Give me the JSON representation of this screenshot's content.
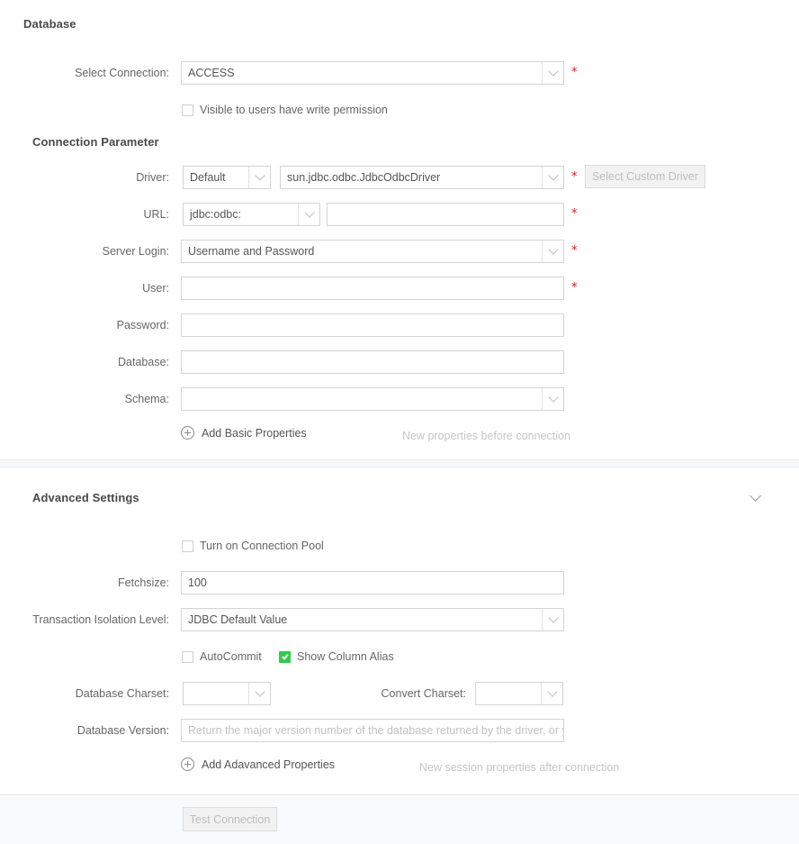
{
  "sections": {
    "database": {
      "title": "Database"
    },
    "connection_parameter": {
      "title": "Connection Parameter"
    },
    "advanced_settings": {
      "title": "Advanced Settings"
    }
  },
  "database": {
    "select_connection": {
      "label": "Select Connection:",
      "value": "ACCESS",
      "required_mark": "*"
    },
    "visible_permission": {
      "label": "Visible to users have write permission",
      "checked": false
    }
  },
  "connection_parameter": {
    "driver": {
      "label": "Driver:",
      "type_value": "Default",
      "class_value": "sun.jdbc.odbc.JdbcOdbcDriver",
      "required_mark": "*",
      "custom_button": "Select Custom Driver"
    },
    "url": {
      "label": "URL:",
      "prefix_value": "jdbc:odbc:",
      "text_value": "",
      "text_placeholder": "",
      "required_mark": "*"
    },
    "server_login": {
      "label": "Server Login:",
      "value": "Username and Password",
      "required_mark": "*"
    },
    "user": {
      "label": "User:",
      "value": "",
      "placeholder": "",
      "required_mark": "*"
    },
    "password": {
      "label": "Password:",
      "value": "",
      "placeholder": ""
    },
    "database": {
      "label": "Database:",
      "value": "",
      "placeholder": ""
    },
    "schema": {
      "label": "Schema:",
      "value": ""
    },
    "add_basic_properties": {
      "label": "Add Basic Properties",
      "hint": "New properties before connection"
    }
  },
  "advanced_settings": {
    "connection_pool": {
      "label": "Turn on Connection Pool",
      "checked": false
    },
    "fetchsize": {
      "label": "Fetchsize:",
      "value": "100"
    },
    "transaction_isolation": {
      "label": "Transaction Isolation Level:",
      "value": "JDBC Default Value"
    },
    "autocommit": {
      "label": "AutoCommit",
      "checked": false
    },
    "show_column_alias": {
      "label": "Show Column Alias",
      "checked": true
    },
    "database_charset": {
      "label": "Database Charset:",
      "value": ""
    },
    "convert_charset": {
      "label": "Convert Charset:",
      "value": ""
    },
    "database_version": {
      "label": "Database Version:",
      "value": "",
      "placeholder": "Return the major version number of the database returned by the driver, or you"
    },
    "add_advanced_properties": {
      "label": "Add Adavanced Properties",
      "hint": "New session properties after connection"
    }
  },
  "footer": {
    "test_connection": "Test Connection"
  },
  "colors": {
    "required": "#e81123",
    "checkbox_on": "#2ecc4a",
    "heading": "#4a4a4a",
    "label": "#666666",
    "border": "#d4d4d4",
    "hint": "#c6c6c6"
  }
}
